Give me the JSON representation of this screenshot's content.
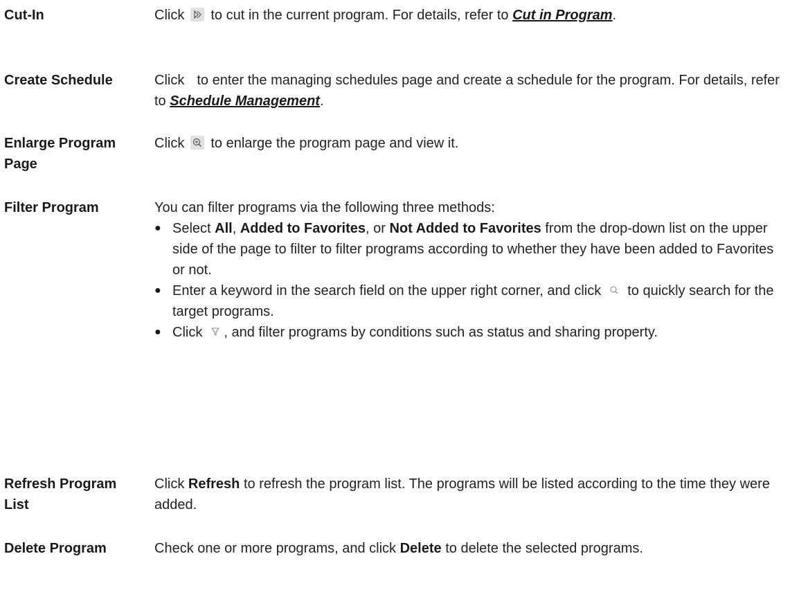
{
  "rows": [
    {
      "term": "Cut-In",
      "desc": {
        "p1": "Click",
        "p2": "to cut in the current program. For details, refer to",
        "link": "Cut in Program",
        "p3": "."
      }
    },
    {
      "term": "Create Schedule",
      "desc": {
        "p1": "Click",
        "p2": "to enter the managing schedules page and create a schedule for the program. For details, refer to",
        "link": "Schedule Management",
        "p3": "."
      }
    },
    {
      "term": "Enlarge Program Page",
      "desc": {
        "p1": "Click",
        "p2": "to enlarge the program page and view it."
      }
    },
    {
      "term": "Filter Program",
      "desc": {
        "intro": "You can filter programs via the following three methods:",
        "b1": {
          "p1": "Select",
          "all": "All",
          "comma1": ",",
          "fav": "Added to Favorites",
          "or": ", or",
          "notfav": "Not Added to Favorites",
          "p2": "from the drop-down list on the upper side of the page to filter to filter programs according to whether they have been added to Favorites or not."
        },
        "b2": {
          "p1": "Enter a keyword in the search field on the upper right corner, and click",
          "p2": "to quickly search for the target programs."
        },
        "b3": {
          "p1": "Click",
          "p2": ", and filter programs by conditions such as status and sharing property."
        }
      }
    },
    {
      "term": "Refresh Program List",
      "desc": {
        "p1": "Click",
        "strong": "Refresh",
        "p2": "to refresh the program list. The programs will be listed according to the time they were added."
      }
    },
    {
      "term": "Delete Program",
      "desc": {
        "p1": "Check one or more programs, and click",
        "strong": "Delete",
        "p2": "to delete the selected programs."
      }
    }
  ],
  "icons": {
    "cut_in": "cut-in-icon",
    "enlarge": "zoom-in-icon",
    "search": "search-icon",
    "filter": "filter-icon"
  },
  "colors": {
    "text": "#222222",
    "icon_bg": "#e1e1e1"
  }
}
